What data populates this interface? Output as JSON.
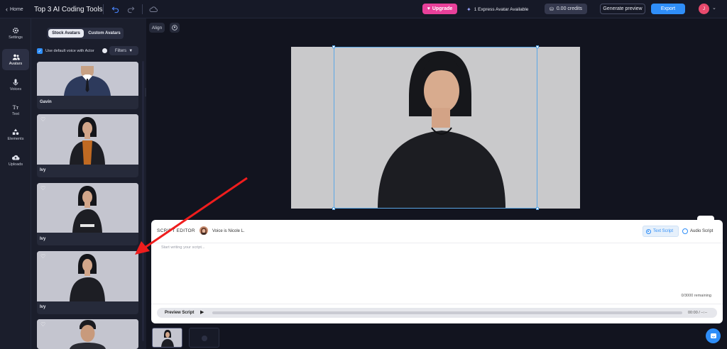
{
  "header": {
    "home_label": "Home",
    "project_title": "Top 3 AI Coding Tools",
    "upgrade_label": "Upgrade",
    "express_label": "1 Express Avatar Available",
    "credits_label": "0.00 credits",
    "generate_preview_label": "Generate preview",
    "export_label": "Export",
    "avatar_initial": "J",
    "colors": {
      "upgrade": "#e8409a",
      "export": "#2f8ef8",
      "avatar": "#e84a6d"
    }
  },
  "sidebar": {
    "items": [
      {
        "label": "Settings",
        "icon": "gear-icon"
      },
      {
        "label": "Avatars",
        "icon": "people-icon"
      },
      {
        "label": "Voices",
        "icon": "mic-icon"
      },
      {
        "label": "Text",
        "icon": "text-icon"
      },
      {
        "label": "Elements",
        "icon": "shapes-icon"
      },
      {
        "label": "Uploads",
        "icon": "cloud-upload-icon"
      }
    ],
    "active": "Avatars"
  },
  "panel": {
    "tabs": [
      "Stock Avatars",
      "Custom Avatars"
    ],
    "active_tab": "Stock Avatars",
    "default_voice_label": "Use default voice with Actor",
    "default_voice_checked": true,
    "filters_label": "Filters",
    "avatars": [
      {
        "name": "Gavin"
      },
      {
        "name": "Ivy"
      },
      {
        "name": "Ivy"
      },
      {
        "name": "Ivy"
      },
      {
        "name": ""
      }
    ]
  },
  "canvas_toolbar": {
    "align_label": "Align"
  },
  "script_editor": {
    "title": "SCRIPT EDITOR",
    "voice_label": "Voice is Nicole L.",
    "text_script_label": "Text Script",
    "audio_script_label": "Audio Script",
    "placeholder": "Start writing your script...",
    "remaining": "0/3000 remaining",
    "preview_label": "Preview Script",
    "time": "00:00 / --:--"
  }
}
